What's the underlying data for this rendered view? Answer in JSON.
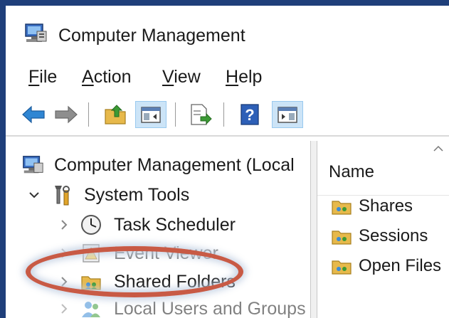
{
  "window": {
    "title": "Computer Management"
  },
  "menubar": {
    "items": [
      {
        "label": "File",
        "mnemonic": "F",
        "rest": "ile"
      },
      {
        "label": "Action",
        "mnemonic": "A",
        "rest": "ction"
      },
      {
        "label": "View",
        "mnemonic": "V",
        "rest": "iew"
      },
      {
        "label": "Help",
        "mnemonic": "H",
        "rest": "elp"
      }
    ]
  },
  "toolbar": {
    "buttons": [
      {
        "name": "back-button",
        "icon": "arrow-left-icon"
      },
      {
        "name": "forward-button",
        "icon": "arrow-right-icon"
      },
      {
        "name": "up-one-level-button",
        "icon": "folder-up-icon"
      },
      {
        "name": "show-hide-console-tree-button",
        "icon": "console-tree-icon",
        "toggled": true
      },
      {
        "name": "export-list-button",
        "icon": "export-list-icon"
      },
      {
        "name": "help-button",
        "icon": "help-icon"
      },
      {
        "name": "show-hide-action-pane-button",
        "icon": "action-pane-icon",
        "toggled": true
      }
    ]
  },
  "tree": {
    "items": [
      {
        "label": "Computer Management (Local",
        "icon": "computer-management-icon",
        "level": 0
      },
      {
        "label": "System Tools",
        "icon": "system-tools-icon",
        "level": 1,
        "expanded": true
      },
      {
        "label": "Task Scheduler",
        "icon": "clock-icon",
        "level": 2
      },
      {
        "label": "Event Viewer",
        "icon": "event-viewer-icon",
        "level": 2
      },
      {
        "label": "Shared Folders",
        "icon": "shared-folder-icon",
        "level": 2,
        "highlighted": true
      },
      {
        "label": "Local Users and Groups",
        "icon": "users-icon",
        "level": 2
      }
    ]
  },
  "list": {
    "column": "Name",
    "items": [
      {
        "label": "Shares",
        "icon": "shared-folder-icon"
      },
      {
        "label": "Sessions",
        "icon": "shared-folder-icon"
      },
      {
        "label": "Open Files",
        "icon": "shared-folder-icon"
      }
    ]
  },
  "colors": {
    "frame": "#1f3f7a",
    "highlight_oval": "#c85a45",
    "toggled_button": "#cce4f7"
  }
}
